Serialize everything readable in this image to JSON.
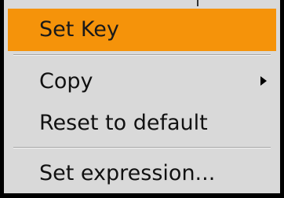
{
  "context_menu": {
    "items": [
      {
        "label": "Set Key",
        "highlighted": true,
        "has_submenu": false
      },
      {
        "label": "Copy",
        "highlighted": false,
        "has_submenu": true,
        "submenu_icon": "chevron-right-icon"
      },
      {
        "label": "Reset to default",
        "highlighted": false,
        "has_submenu": false
      },
      {
        "label": "Set expression...",
        "highlighted": false,
        "has_submenu": false
      }
    ],
    "colors": {
      "highlight": "#f5930a",
      "background": "#d9d9d9",
      "border": "#000000"
    }
  }
}
